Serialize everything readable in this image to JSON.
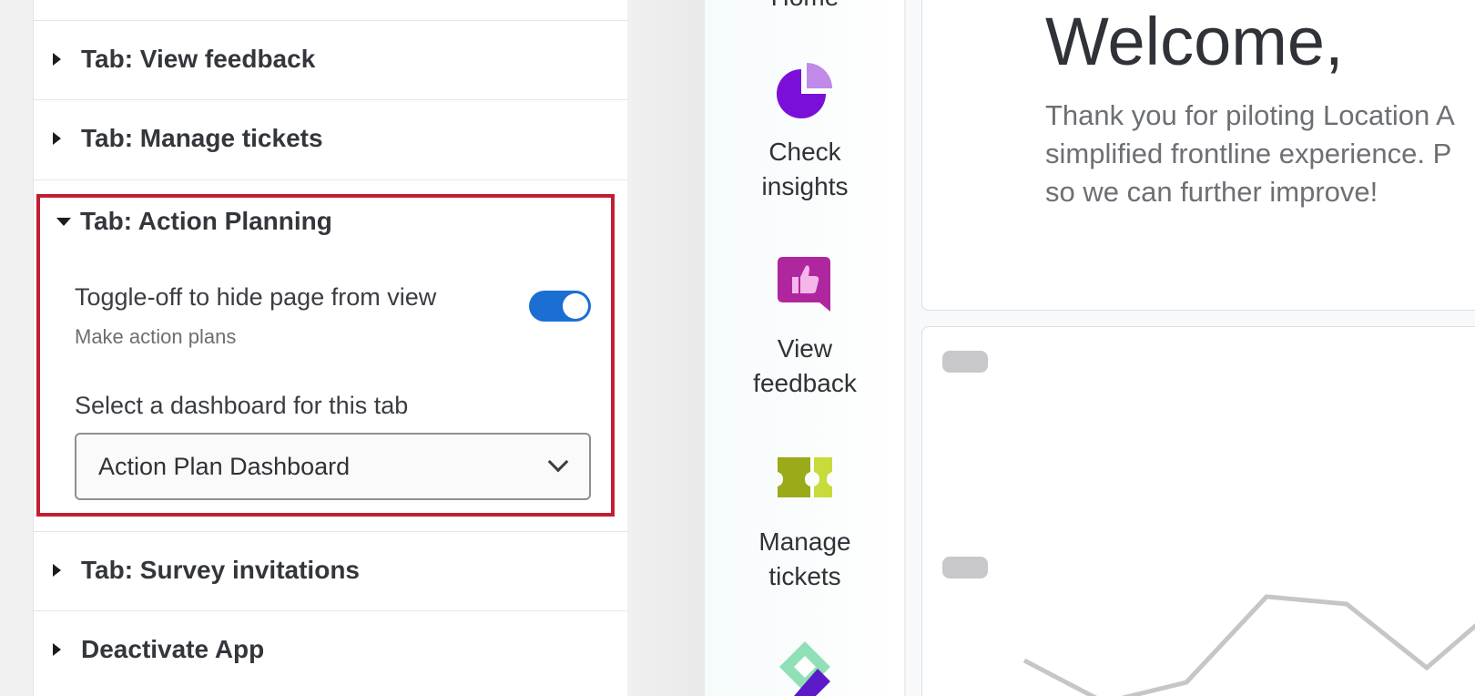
{
  "settings": {
    "tabs": [
      {
        "label": "Tab: View feedback"
      },
      {
        "label": "Tab: Manage tickets"
      },
      {
        "label": "Tab: Action Planning"
      },
      {
        "label": "Tab: Survey invitations"
      },
      {
        "label": "Deactivate App"
      }
    ],
    "action_planning": {
      "toggle_label": "Toggle-off to hide page from view",
      "toggle_sublabel": "Make action plans",
      "toggle_on": true,
      "select_label": "Select a dashboard for this tab",
      "select_value": "Action Plan Dashboard"
    }
  },
  "nav": {
    "home_label": "Home",
    "items": [
      {
        "line1": "Check",
        "line2": "insights",
        "icon": "pie-chart-icon"
      },
      {
        "line1": "View",
        "line2": "feedback",
        "icon": "thumbs-up-icon"
      },
      {
        "line1": "Manage",
        "line2": "tickets",
        "icon": "ticket-icon"
      },
      {
        "icon": "diamond-logo-icon"
      }
    ]
  },
  "main": {
    "welcome_title": "Welcome,",
    "welcome_lines": [
      "Thank you for piloting Location A",
      "simplified frontline experience. P",
      "so we can further improve!"
    ]
  },
  "colors": {
    "highlight": "#c21e32",
    "toggle": "#1b6fd3",
    "insights_purple": "#7a10d8",
    "feedback_magenta": "#b0269e",
    "tickets_green": "#9aaa18",
    "tickets_light": "#c7dc3a"
  }
}
